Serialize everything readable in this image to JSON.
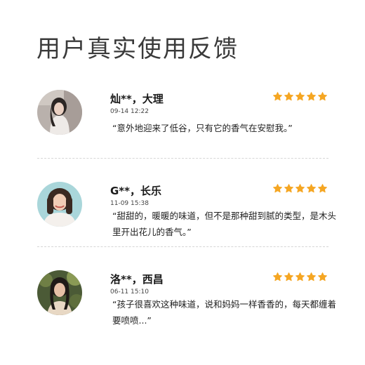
{
  "page": {
    "title": "用户真实使用反馈"
  },
  "colors": {
    "star": "#f5a623",
    "divider": "#d6d6d6"
  },
  "reviews": [
    {
      "name": "灿**，大理",
      "date": "09-14 12:22",
      "rating": 5,
      "text": "“意外地迎来了低谷，只有它的香气在安慰我。”"
    },
    {
      "name": "G**，长乐",
      "date": "11-09 15:38",
      "rating": 5,
      "text": "“甜甜的，暖暖的味道，但不是那种甜到腻的类型，是木头里开出花儿的香气。”"
    },
    {
      "name": "洛**，西昌",
      "date": "06-11 15:10",
      "rating": 5,
      "text": "“孩子很喜欢这种味道，说和妈妈一样香香的，每天都缠着要喷喷...”"
    }
  ]
}
